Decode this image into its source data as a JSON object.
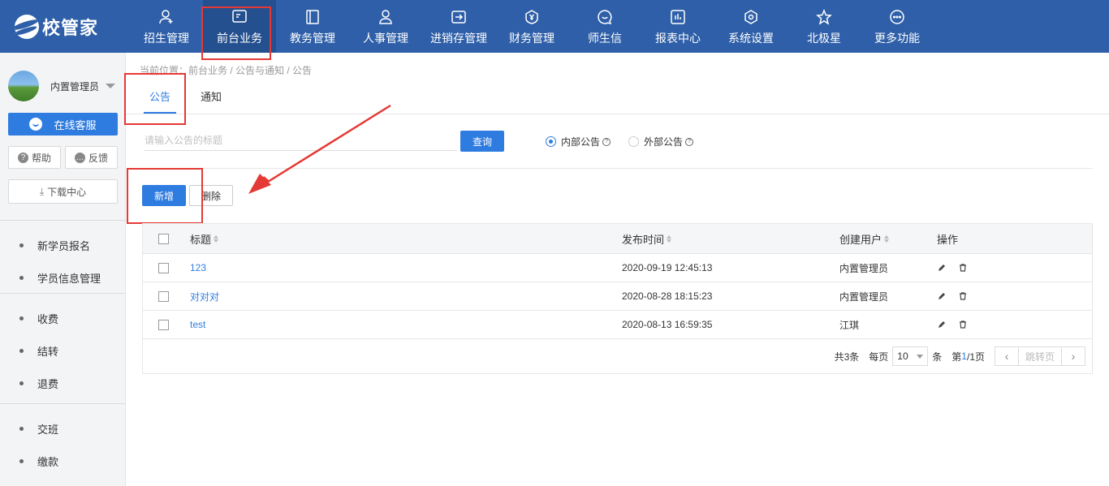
{
  "app": {
    "logo_text": "校管家"
  },
  "nav": [
    {
      "label": "招生管理",
      "icon": "user-add-icon"
    },
    {
      "label": "前台业务",
      "icon": "monitor-icon",
      "active": true
    },
    {
      "label": "教务管理",
      "icon": "book-icon"
    },
    {
      "label": "人事管理",
      "icon": "person-icon"
    },
    {
      "label": "进销存管理",
      "icon": "inventory-icon"
    },
    {
      "label": "财务管理",
      "icon": "finance-icon"
    },
    {
      "label": "师生信",
      "icon": "chat-icon"
    },
    {
      "label": "报表中心",
      "icon": "report-icon"
    },
    {
      "label": "系统设置",
      "icon": "settings-icon"
    },
    {
      "label": "北极星",
      "icon": "star-icon"
    },
    {
      "label": "更多功能",
      "icon": "more-icon"
    }
  ],
  "sidebar": {
    "user_name": "内置管理员",
    "service_label": "在线客服",
    "help_label": "帮助",
    "feedback_label": "反馈",
    "download_label": "下载中心",
    "groups": [
      [
        "新学员报名",
        "学员信息管理"
      ],
      [
        "收费",
        "结转",
        "退费"
      ],
      [
        "交班",
        "缴款"
      ]
    ]
  },
  "breadcrumb": "当前位置：前台业务 / 公告与通知 / 公告",
  "tabs": [
    "公告",
    "通知"
  ],
  "search": {
    "placeholder": "请输入公告的标题",
    "value": "",
    "query_label": "查询"
  },
  "radios": [
    {
      "label": "内部公告",
      "checked": true
    },
    {
      "label": "外部公告",
      "checked": false
    }
  ],
  "actions": {
    "add_label": "新增",
    "delete_label": "删除"
  },
  "table": {
    "columns": [
      "标题",
      "发布时间",
      "创建用户",
      "操作"
    ],
    "rows": [
      {
        "title": "123",
        "time": "2020-09-19 12:45:13",
        "user": "内置管理员"
      },
      {
        "title": "对对对",
        "time": "2020-08-28 18:15:23",
        "user": "内置管理员"
      },
      {
        "title": "test",
        "time": "2020-08-13 16:59:35",
        "user": "江琪"
      }
    ]
  },
  "pager": {
    "total_text": "共3条",
    "per_page_label": "每页",
    "per_page_value": "10",
    "unit_label": "条",
    "page_prefix": "第",
    "current_page": "1",
    "page_suffix": "/1页",
    "jump_label": "跳转页",
    "prev_symbol": "‹",
    "next_symbol": "›"
  },
  "colors": {
    "primary": "#2f7ce0",
    "topbar": "#2e5fa8",
    "annotation": "#e53935"
  }
}
